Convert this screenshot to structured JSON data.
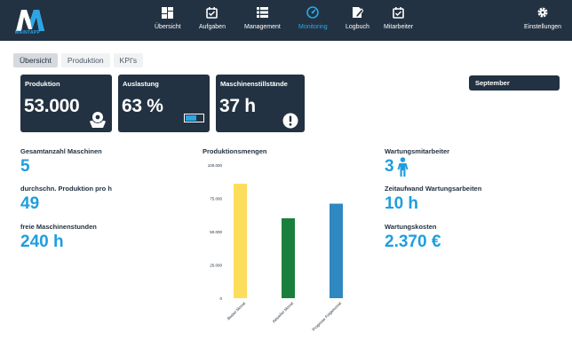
{
  "app": {
    "logo_text": "MAINTAPP"
  },
  "nav": {
    "items": [
      {
        "id": "uebersicht",
        "label": "Übersicht",
        "icon": "dashboard-icon"
      },
      {
        "id": "aufgaben",
        "label": "Aufgaben",
        "icon": "checkbox-icon"
      },
      {
        "id": "management",
        "label": "Management",
        "icon": "list-icon"
      },
      {
        "id": "monitoring",
        "label": "Monitoring",
        "icon": "gauge-icon",
        "active": true
      },
      {
        "id": "logbuch",
        "label": "Logbuch",
        "icon": "edit-icon"
      },
      {
        "id": "mitarbeiter",
        "label": "Mitarbeiter",
        "icon": "checkbox-icon"
      },
      {
        "id": "einstellungen",
        "label": "Einstellungen",
        "icon": "gear-icon"
      }
    ]
  },
  "tabs": [
    {
      "label": "Übersicht",
      "active": true
    },
    {
      "label": "Produktion"
    },
    {
      "label": "KPI's"
    }
  ],
  "cards": {
    "produktion": {
      "title": "Produktion",
      "value": "53.000",
      "icon": "hand-gear-icon"
    },
    "auslastung": {
      "title": "Auslastung",
      "value": "63 %",
      "icon": "battery-icon",
      "level": 0.63
    },
    "stillstaende": {
      "title": "Maschinenstillstände",
      "value": "37 h",
      "icon": "alert-icon"
    }
  },
  "month": {
    "selected": "September"
  },
  "left_stats": [
    {
      "label": "Gesamtanzahl Maschinen",
      "value": "5"
    },
    {
      "label": "durchschn. Produktion pro h",
      "value": "49"
    },
    {
      "label": "freie Maschinenstunden",
      "value": "240 h"
    }
  ],
  "right_stats": [
    {
      "label": "Wartungsmitarbeiter",
      "value": "3",
      "icon": "person-icon"
    },
    {
      "label": "Zeitaufwand Wartungsarbeiten",
      "value": "10 h"
    },
    {
      "label": "Wartungskosten",
      "value": "2.370 €"
    }
  ],
  "colors": {
    "navy": "#233242",
    "accent": "#1e9ee0",
    "bar1": "#fddd5c",
    "bar2": "#1a7f3c",
    "bar3": "#2f88c0"
  },
  "chart_data": {
    "type": "bar",
    "title": "Produktionsmengen",
    "categories": [
      "Bester Monat",
      "Aktueller Monat",
      "Prognose Folgemonat"
    ],
    "values": [
      86000,
      60000,
      71000
    ],
    "colors": [
      "#fddd5c",
      "#1a7f3c",
      "#2f88c0"
    ],
    "ylim": [
      0,
      100000
    ],
    "yticks": [
      0,
      25000,
      50000,
      75000,
      100000
    ],
    "ytick_labels": [
      "0",
      "25.000",
      "50.000",
      "75.000",
      "100.000"
    ],
    "grid": false
  }
}
